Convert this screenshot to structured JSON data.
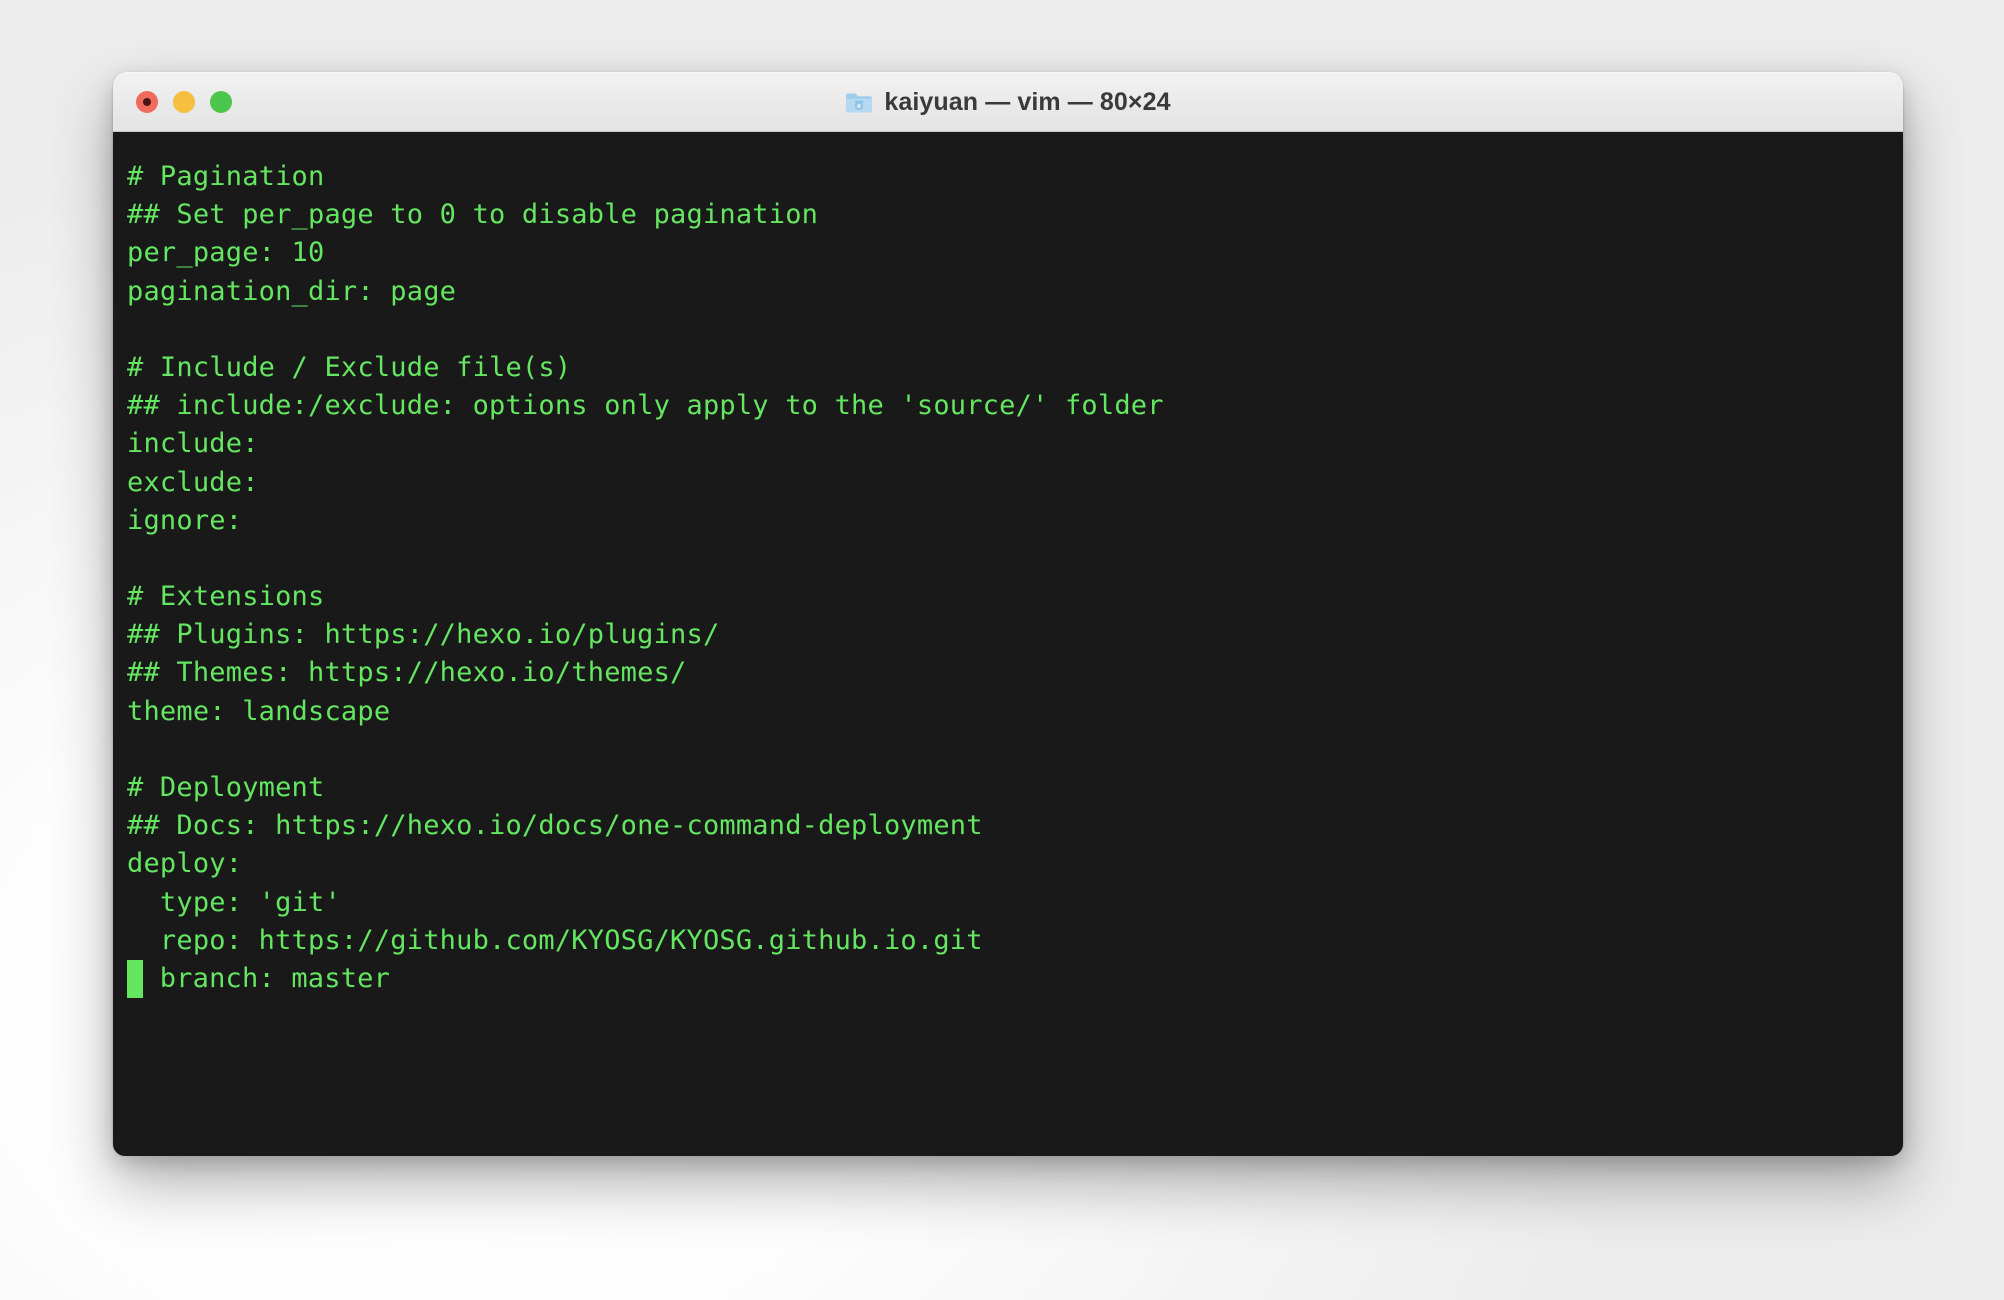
{
  "window": {
    "title": "kaiyuan — vim — 80×24",
    "folder_icon": "folder-icon",
    "controls": [
      {
        "name": "close-button",
        "label": "Close",
        "color": "#ef6b5e"
      },
      {
        "name": "minimize-button",
        "label": "Minimize",
        "color": "#f5bf3f"
      },
      {
        "name": "zoom-button",
        "label": "Zoom",
        "color": "#4cc64c"
      }
    ]
  },
  "terminal": {
    "app": "vim",
    "size": "80×24",
    "background_color": "#191919",
    "foreground_color": "#64e661",
    "cursor": {
      "row": 23,
      "column": 1,
      "style": "block",
      "color": "#64e661"
    },
    "lines": [
      "# Pagination",
      "## Set per_page to 0 to disable pagination",
      "per_page: 10",
      "pagination_dir: page",
      "",
      "# Include / Exclude file(s)",
      "## include:/exclude: options only apply to the 'source/' folder",
      "include:",
      "exclude:",
      "ignore:",
      "",
      "# Extensions",
      "## Plugins: https://hexo.io/plugins/",
      "## Themes: https://hexo.io/themes/",
      "theme: landscape",
      "",
      "# Deployment",
      "## Docs: https://hexo.io/docs/one-command-deployment",
      "deploy:",
      "  type: 'git'",
      "  repo: https://github.com/KYOSG/KYOSG.github.io.git",
      "  branch: master"
    ],
    "cursor_line_index": 21,
    "cursor_line_prefix": " ",
    "cursor_line_rest": " branch: master"
  }
}
